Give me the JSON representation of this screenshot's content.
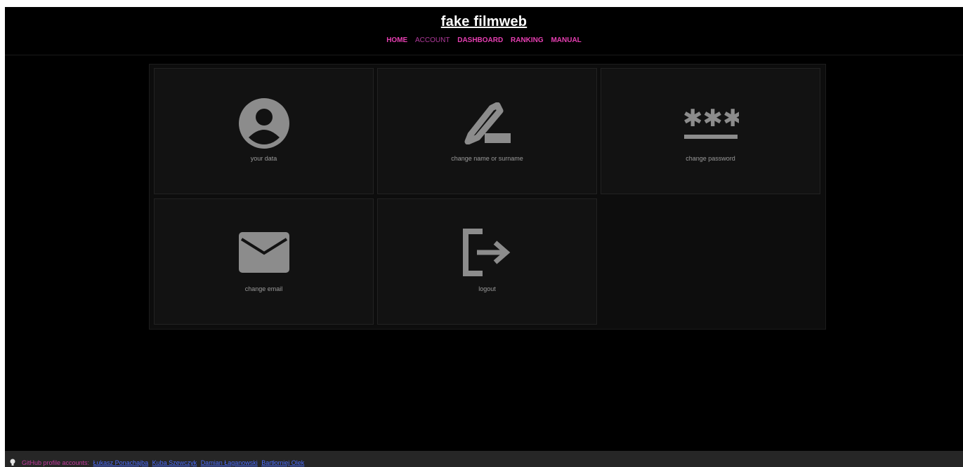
{
  "site": {
    "title": "fake filmweb"
  },
  "nav": {
    "items": [
      {
        "label": "HOME"
      },
      {
        "label": "ACCOUNT"
      },
      {
        "label": "DASHBOARD"
      },
      {
        "label": "RANKING"
      },
      {
        "label": "MANUAL"
      }
    ],
    "active": "ACCOUNT"
  },
  "tiles": [
    {
      "label": "your data",
      "icon": "user-circle-icon"
    },
    {
      "label": "change name or surname",
      "icon": "pencil-icon"
    },
    {
      "label": "change password",
      "icon": "password-asterisks-icon"
    },
    {
      "label": "change email",
      "icon": "envelope-icon"
    },
    {
      "label": "logout",
      "icon": "logout-icon"
    }
  ],
  "footer": {
    "prefix": "GitHub profile accounts:",
    "links": [
      {
        "label": "Łukasz Ponachajba"
      },
      {
        "label": "Kuba Szewczyk"
      },
      {
        "label": "Damian Łaganowski"
      },
      {
        "label": "Bartłomiej Olek"
      }
    ]
  },
  "colors": {
    "accent": "#e73fb2",
    "active_nav": "#b03a9a",
    "tile_bg": "#121212",
    "icon": "#8c8c8c",
    "link": "#4a6cff"
  }
}
